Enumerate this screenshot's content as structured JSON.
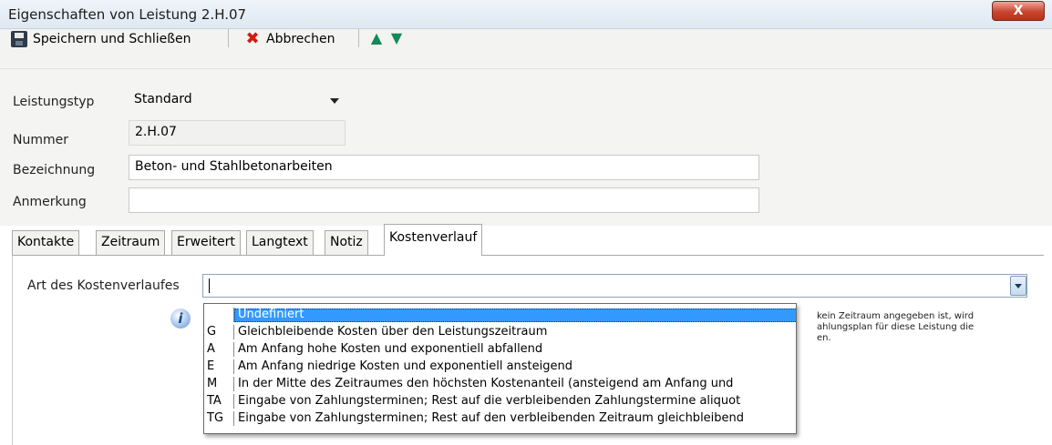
{
  "window": {
    "title": "Eigenschaften von Leistung 2.H.07",
    "close_glyph": "X"
  },
  "toolbar": {
    "save_label": "Speichern und Schließen",
    "cancel_label": "Abbrechen",
    "up_glyph": "🡅",
    "down_glyph": "🡇"
  },
  "form": {
    "leistungstyp": {
      "label": "Leistungstyp",
      "value": "Standard"
    },
    "nummer": {
      "label": "Nummer",
      "value": "2.H.07"
    },
    "bezeichnung": {
      "label": "Bezeichnung",
      "value": "Beton- und Stahlbetonarbeiten"
    },
    "anmerkung": {
      "label": "Anmerkung",
      "value": ""
    }
  },
  "tabs": [
    "Kontakte",
    "Zeitraum",
    "Erweitert",
    "Langtext",
    "Notiz",
    "Kostenverlauf"
  ],
  "active_tab": "Kostenverlauf",
  "kostenverlauf": {
    "label": "Art des Kostenverlaufes",
    "value": "",
    "info_glyph": "i",
    "hint_lines": [
      "kein Zeitraum angegeben ist, wird",
      "ahlungsplan für diese Leistung die",
      "en."
    ],
    "options": [
      {
        "code": "",
        "text": "Undefiniert"
      },
      {
        "code": "G",
        "text": "Gleichbleibende Kosten über den Leistungszeitraum"
      },
      {
        "code": "A",
        "text": "Am Anfang hohe Kosten und exponentiell abfallend"
      },
      {
        "code": "E",
        "text": "Am Anfang niedrige Kosten und exponentiell ansteigend"
      },
      {
        "code": "M",
        "text": "In der Mitte des Zeitraumes den höchsten Kostenanteil (ansteigend am Anfang und"
      },
      {
        "code": "TA",
        "text": "Eingabe von Zahlungsterminen; Rest auf die verbleibenden Zahlungstermine aliquot"
      },
      {
        "code": "TG",
        "text": "Eingabe von Zahlungsterminen; Rest auf den verbleibenden Zeitraum gleichbleibend"
      }
    ]
  },
  "colors": {
    "selection": "#3399ff",
    "close_button": "#c9452f",
    "arrow": "#128a5a"
  }
}
